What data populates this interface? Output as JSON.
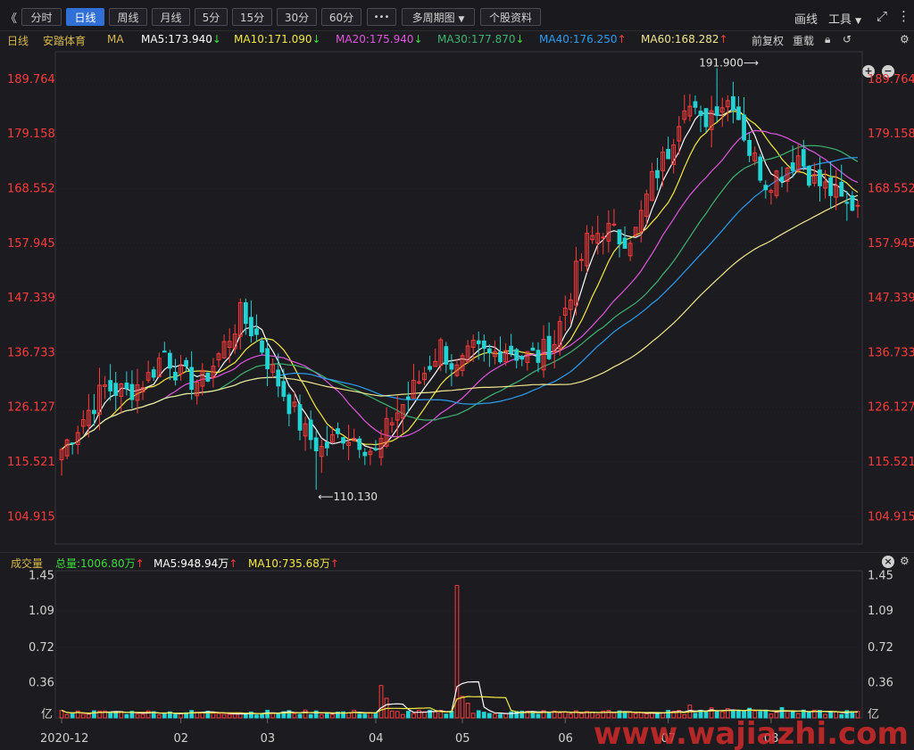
{
  "toolbar": {
    "back_glyph": "《",
    "periods": [
      "分时",
      "日线",
      "周线",
      "月线",
      "5分",
      "15分",
      "30分",
      "60分"
    ],
    "active_period": "日线",
    "more_label": "•••",
    "multi_period": "多周期图",
    "stock_info": "个股资料",
    "draw_label": "画线",
    "tools_label": "工具"
  },
  "ma_bar": {
    "period_label": "日线",
    "stock_name": "安踏体育",
    "indicator": "MA",
    "items": [
      {
        "label": "MA5:173.940",
        "dir": "down",
        "color": "#ffffff"
      },
      {
        "label": "MA10:171.090",
        "dir": "down",
        "color": "#f4e842"
      },
      {
        "label": "MA20:175.940",
        "dir": "down",
        "color": "#e055e0"
      },
      {
        "label": "MA30:177.870",
        "dir": "down",
        "color": "#3cb371"
      },
      {
        "label": "MA40:176.250",
        "dir": "up",
        "color": "#2a9df4"
      },
      {
        "label": "MA60:168.282",
        "dir": "up",
        "color": "#f0e68c"
      }
    ],
    "adjust_label": "前复权",
    "overlay_label": "重载"
  },
  "volume_bar": {
    "title": "成交量",
    "total": "总量:1006.80万",
    "ma5": "MA5:948.94万",
    "ma10": "MA10:735.68万"
  },
  "colors": {
    "up": "#ff3b3b",
    "down": "#23d3d3",
    "ma5": "#ffffff",
    "ma10": "#f4e842",
    "ma20": "#e055e0",
    "ma30": "#3cb371",
    "ma40": "#2a9df4",
    "ma60": "#f0e68c",
    "axis_price": "#ff3b3b"
  },
  "chart_data": [
    {
      "type": "candlestick",
      "y_ticks": [
        "189.764",
        "179.158",
        "168.552",
        "157.945",
        "147.339",
        "136.733",
        "126.127",
        "115.521",
        "104.915"
      ],
      "ylim": [
        99.6,
        195.1
      ],
      "annotations": [
        {
          "label": "191.900",
          "x_index": 121
        },
        {
          "label": "110.130",
          "x_index": 47
        }
      ],
      "x_labels": [
        "2020-12",
        "02",
        "03",
        "04",
        "05",
        "06",
        "07",
        "08"
      ],
      "x_label_index": [
        0,
        22,
        38,
        58,
        74,
        93,
        112,
        131
      ],
      "candles": []
    },
    {
      "type": "bar",
      "y_ticks": [
        "1.45",
        "1.09",
        "0.72",
        "0.36"
      ],
      "unit_label": "亿",
      "ylim": [
        0,
        1.5
      ],
      "values": []
    }
  ],
  "watermark": "www.wajiazhi.com"
}
